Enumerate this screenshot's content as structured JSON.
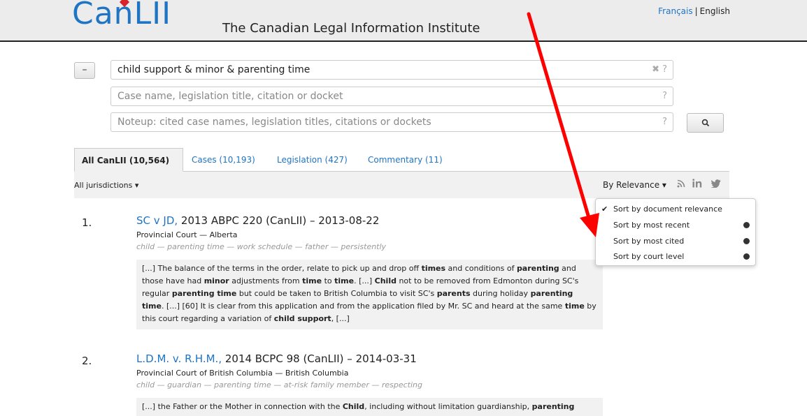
{
  "header": {
    "logo": "CanLII",
    "tagline": "The Canadian Legal Information Institute",
    "lang_fr": "Français",
    "lang_sep": "|",
    "lang_en": "English"
  },
  "search": {
    "collapse_label": "–",
    "query": "child support & minor & parenting time",
    "query_icons": "✖ ?",
    "case_placeholder": "Case name, legislation title, citation or docket",
    "case_icons": "?",
    "noteup_placeholder": "Noteup: cited case names, legislation titles, citations or dockets",
    "noteup_icons": "?"
  },
  "tabs": [
    {
      "label": "All CanLII (10,564)"
    },
    {
      "label": "Cases (10,193)"
    },
    {
      "label": "Legislation (427)"
    },
    {
      "label": "Commentary (11)"
    }
  ],
  "filters": {
    "jurisdiction": "All jurisdictions ▾",
    "sort": "By Relevance ▾"
  },
  "sort_menu": [
    {
      "label": "Sort by document relevance",
      "checked": true
    },
    {
      "label": "Sort by most recent"
    },
    {
      "label": "Sort by most cited"
    },
    {
      "label": "Sort by court level"
    }
  ],
  "results": [
    {
      "num": "1.",
      "title": "SC v JD,",
      "citation": " 2013 ABPC 220 (CanLII) – 2013-08-22",
      "court": "Provincial Court — Alberta",
      "keywords": "child — parenting time — work schedule — father — persistently"
    },
    {
      "num": "2.",
      "title": "L.D.M. v. R.H.M.,",
      "citation": " 2014 BCPC 98 (CanLII) – 2014-03-31",
      "court": "Provincial Court of British Columbia — British Columbia",
      "keywords": "child — guardian — parenting time — at-risk family member — respecting"
    }
  ],
  "snippet1_segments": [
    {
      "t": "[...]  The balance of the terms in the order, relate to pick up and drop off "
    },
    {
      "t": "times",
      "b": true
    },
    {
      "t": " and conditions of "
    },
    {
      "t": "parenting",
      "b": true
    },
    {
      "t": " and those have had "
    },
    {
      "t": "minor",
      "b": true
    },
    {
      "t": " adjustments from "
    },
    {
      "t": "time",
      "b": true
    },
    {
      "t": " to "
    },
    {
      "t": "time",
      "b": true
    },
    {
      "t": ".  [...]   "
    },
    {
      "t": "Child",
      "b": true
    },
    {
      "t": " not to be removed from Edmonton during SC's regular "
    },
    {
      "t": "parenting time",
      "b": true
    },
    {
      "t": " but could be taken to British Columbia to visit SC's "
    },
    {
      "t": "parents",
      "b": true
    },
    {
      "t": " during holiday "
    },
    {
      "t": "parenting time",
      "b": true
    },
    {
      "t": ".  [...]  [60] It is clear from this application and from the application filed by Mr. SC and heard at the same "
    },
    {
      "t": "time",
      "b": true
    },
    {
      "t": " by this court regarding a variation of "
    },
    {
      "t": "child support",
      "b": true
    },
    {
      "t": ",   [...]"
    }
  ],
  "snippet2_segments": [
    {
      "t": "[...]  the Father or the Mother in connection with the "
    },
    {
      "t": "Child",
      "b": true
    },
    {
      "t": ", including without limitation guardianship, "
    },
    {
      "t": "parenting",
      "b": true
    }
  ],
  "colors": {
    "link": "#1f74c4",
    "arrow": "#ff0000"
  }
}
